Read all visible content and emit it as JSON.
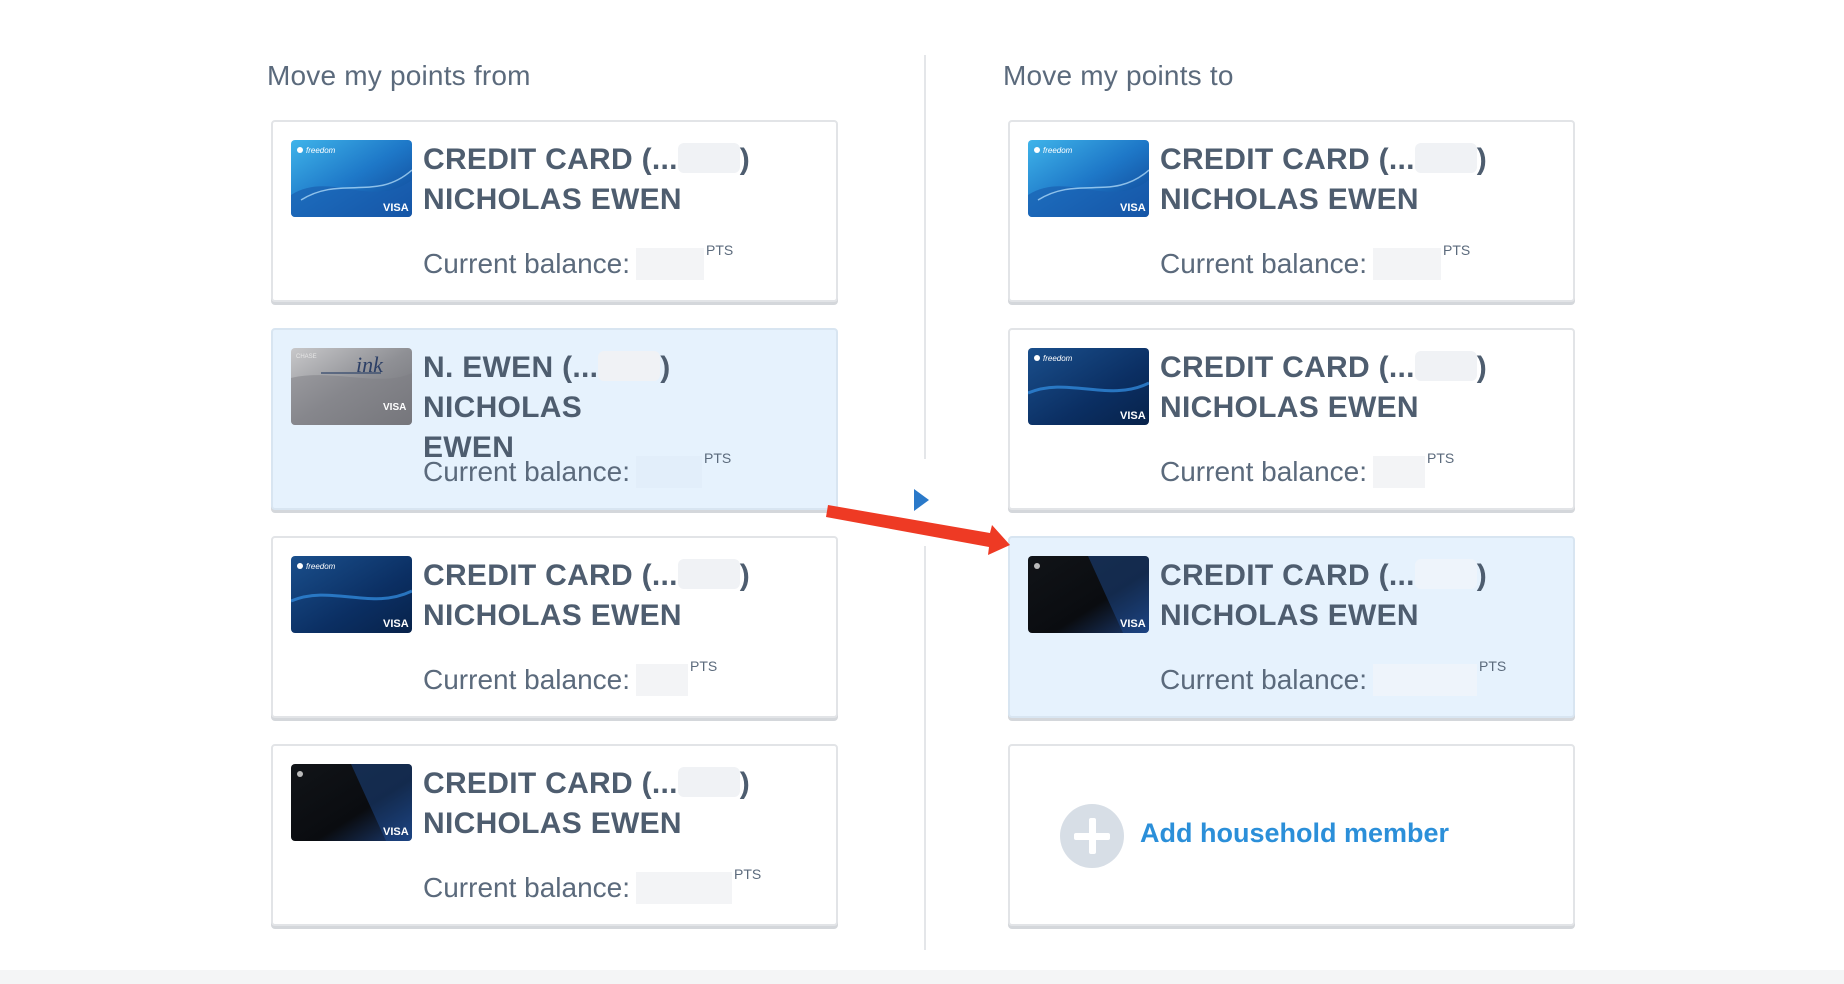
{
  "left_column": {
    "heading": "Move my points from",
    "cards": [
      {
        "name_a": "CREDIT CARD (...",
        "name_b": ")",
        "name_c": "NICHOLAS EWEN",
        "balance_label": "Current balance:",
        "unit": "PTS",
        "art": "freedom-blue",
        "selected": false
      },
      {
        "name_a": "N. EWEN (...",
        "name_b": ") NICHOLAS",
        "name_c": "EWEN",
        "balance_label": "Current balance:",
        "unit": "PTS",
        "art": "ink-silver",
        "selected": true
      },
      {
        "name_a": "CREDIT CARD (...",
        "name_b": ")",
        "name_c": "NICHOLAS EWEN",
        "balance_label": "Current balance:",
        "unit": "PTS",
        "art": "freedom-unlimited",
        "selected": false
      },
      {
        "name_a": "CREDIT CARD (...",
        "name_b": ")",
        "name_c": "NICHOLAS EWEN",
        "balance_label": "Current balance:",
        "unit": "PTS",
        "art": "sapphire-black",
        "selected": false
      }
    ]
  },
  "right_column": {
    "heading": "Move my points to",
    "cards": [
      {
        "name_a": "CREDIT CARD (...",
        "name_b": ")",
        "name_c": "NICHOLAS EWEN",
        "balance_label": "Current balance:",
        "unit": "PTS",
        "art": "freedom-blue",
        "selected": false
      },
      {
        "name_a": "CREDIT CARD (...",
        "name_b": ")",
        "name_c": "NICHOLAS EWEN",
        "balance_label": "Current balance:",
        "unit": "PTS",
        "art": "freedom-unlimited",
        "selected": false
      },
      {
        "name_a": "CREDIT CARD (...",
        "name_b": ")",
        "name_c": "NICHOLAS EWEN",
        "balance_label": "Current balance:",
        "unit": "PTS",
        "art": "sapphire-black",
        "selected": true
      }
    ],
    "add_member_label": "Add household member"
  },
  "colors": {
    "selected_bg": "#e6f2fd",
    "link_blue": "#2b8fd9",
    "annotation_red": "#ee3a24",
    "caret_blue": "#2a79c9"
  },
  "icons": {
    "divider": "caret-right-icon",
    "add": "plus-circle-icon",
    "annotation": "red-arrow-annotation"
  }
}
